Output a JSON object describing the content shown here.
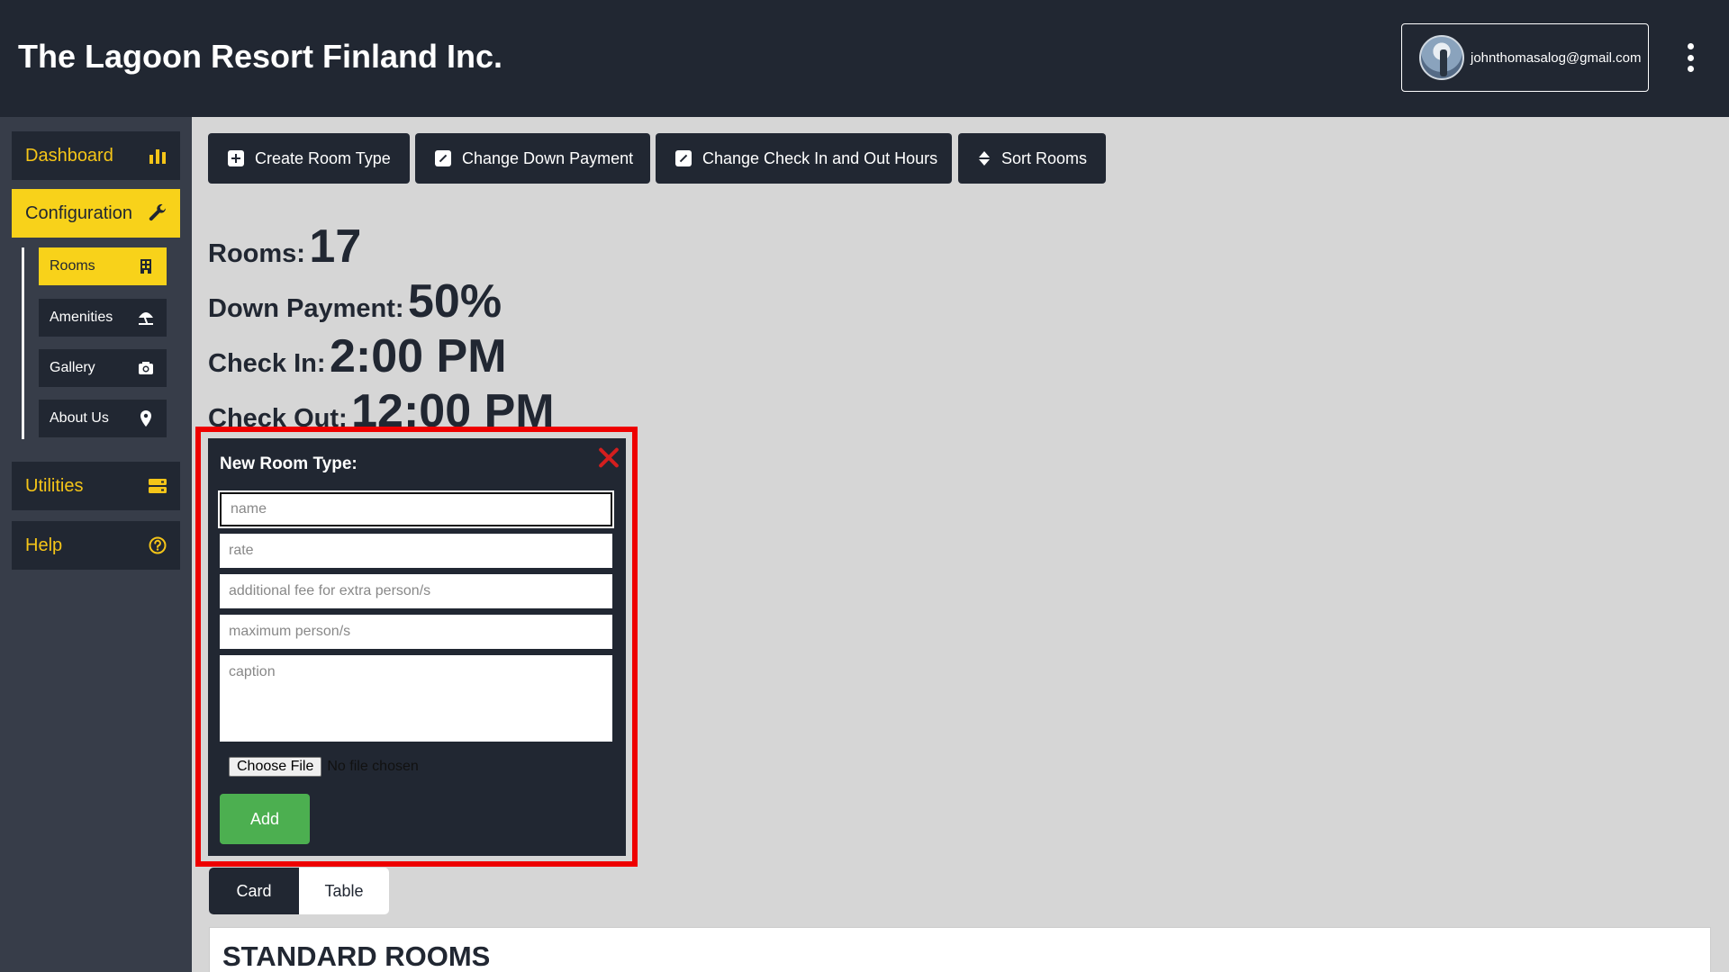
{
  "header": {
    "title": "The Lagoon Resort Finland Inc.",
    "user_email": "johnthomasalog@gmail.com"
  },
  "sidebar": {
    "items": [
      {
        "label": "Dashboard",
        "icon": "bar-chart-icon"
      },
      {
        "label": "Configuration",
        "icon": "wrench-icon",
        "active": true
      },
      {
        "label": "Utilities",
        "icon": "server-icon"
      },
      {
        "label": "Help",
        "icon": "question-circle-icon"
      }
    ],
    "sub_items": [
      {
        "label": "Rooms",
        "icon": "building-icon",
        "active": true
      },
      {
        "label": "Amenities",
        "icon": "umbrella-beach-icon"
      },
      {
        "label": "Gallery",
        "icon": "camera-icon"
      },
      {
        "label": "About Us",
        "icon": "map-pin-icon"
      }
    ]
  },
  "toolbar": {
    "create_room_type": "Create Room Type",
    "change_down_payment": "Change Down Payment",
    "change_check_hours": "Change Check In and Out Hours",
    "sort_rooms": "Sort Rooms"
  },
  "stats": {
    "rooms_label": "Rooms:",
    "rooms_value": "17",
    "down_payment_label": "Down Payment:",
    "down_payment_value": "50%",
    "check_in_label": "Check In:",
    "check_in_value": "2:00 PM",
    "check_out_label": "Check Out:",
    "check_out_value": "12:00 PM"
  },
  "modal": {
    "title": "New Room Type:",
    "name_placeholder": "name",
    "rate_placeholder": "rate",
    "extra_fee_placeholder": "additional fee for extra person/s",
    "max_persons_placeholder": "maximum person/s",
    "caption_placeholder": "caption",
    "file_button": "Choose File",
    "file_status": "No file chosen",
    "add_label": "Add"
  },
  "view_toggle": {
    "card": "Card",
    "table": "Table",
    "active": "Card"
  },
  "rooms_section": {
    "heading": "STANDARD ROOMS"
  },
  "colors": {
    "dark": "#212732",
    "sidebar": "#373d49",
    "accent": "#f8d21a",
    "highlight": "#ee0000",
    "add_button": "#4caf50",
    "content_bg": "#d6d6d6"
  }
}
